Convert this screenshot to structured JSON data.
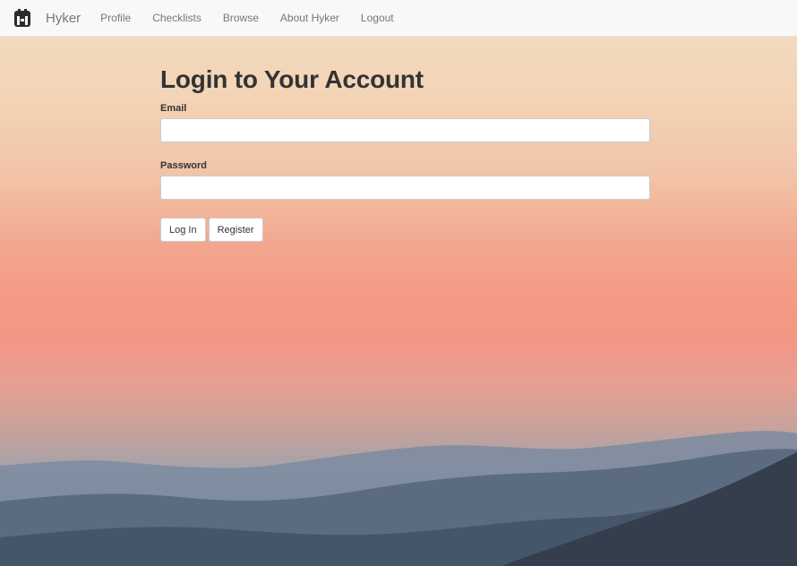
{
  "navbar": {
    "brand": "Hyker",
    "links": [
      "Profile",
      "Checklists",
      "Browse",
      "About Hyker",
      "Logout"
    ]
  },
  "login": {
    "title": "Login to Your Account",
    "email_label": "Email",
    "email_value": "",
    "password_label": "Password",
    "password_value": "",
    "login_button": "Log In",
    "register_button": "Register"
  }
}
